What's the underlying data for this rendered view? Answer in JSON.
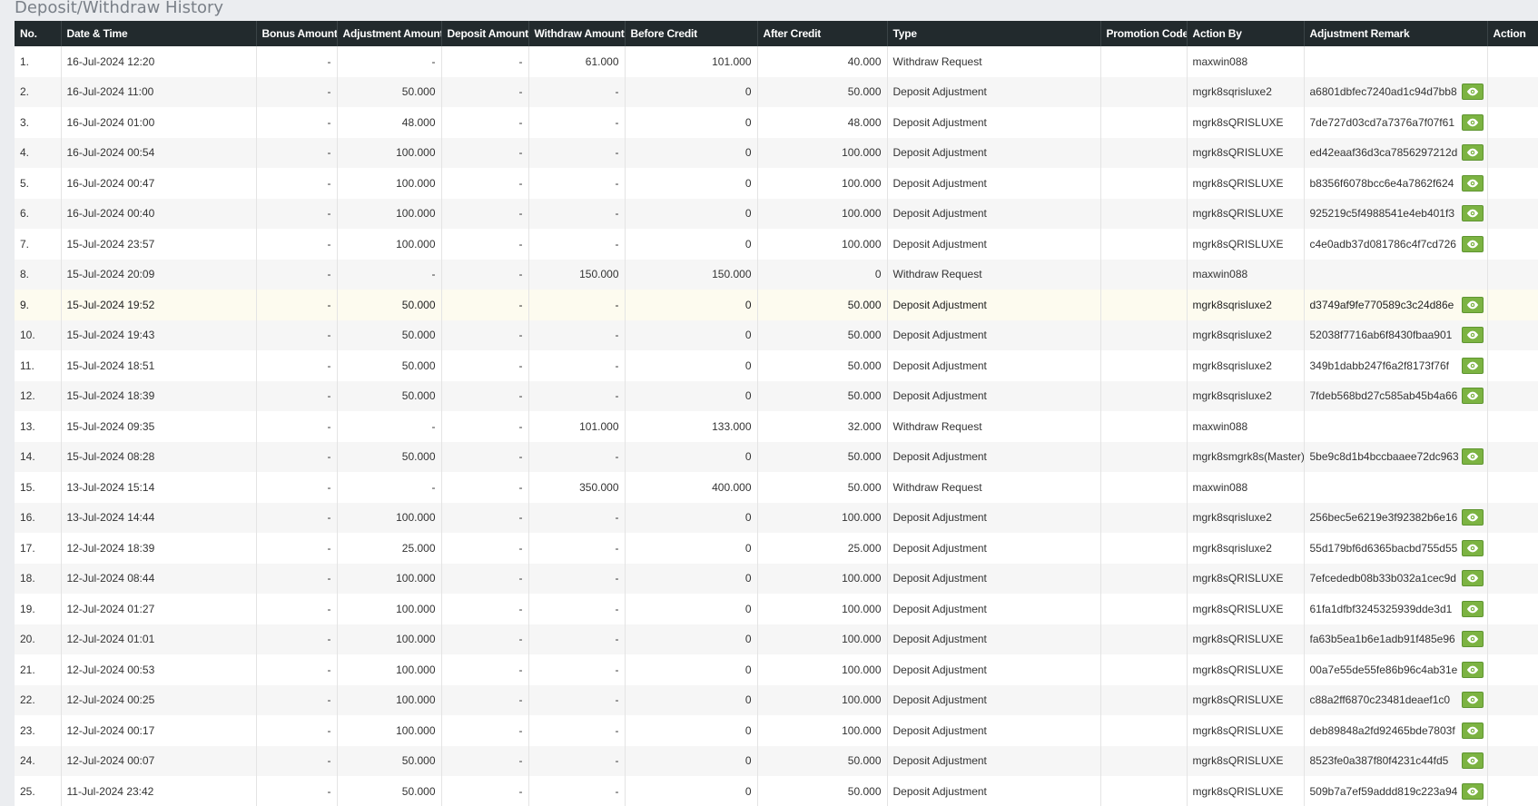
{
  "page_title": "Deposit/Withdraw History",
  "columns": [
    "No.",
    "Date & Time",
    "Bonus Amount",
    "Adjustment Amount",
    "Deposit Amount",
    "Withdraw Amount",
    "Before Credit",
    "After Credit",
    "Type",
    "Promotion Code",
    "Action By",
    "Adjustment Remark",
    "Action"
  ],
  "colors": {
    "header_bg": "#222a2d",
    "eye_button": "#7cb342",
    "highlight_row": "#fdfbef"
  },
  "view_icon": "eye-icon",
  "rows": [
    {
      "no": "1.",
      "date": "16-Jul-2024 12:20",
      "bonus": "-",
      "adjustment": "-",
      "deposit": "-",
      "withdraw": "61.000",
      "before": "101.000",
      "after": "40.000",
      "type": "Withdraw Request",
      "promo": "",
      "by": "maxwin088",
      "remark": "",
      "has_view": false
    },
    {
      "no": "2.",
      "date": "16-Jul-2024 11:00",
      "bonus": "-",
      "adjustment": "50.000",
      "deposit": "-",
      "withdraw": "-",
      "before": "0",
      "after": "50.000",
      "type": "Deposit Adjustment",
      "promo": "",
      "by": "mgrk8sqrisluxe2",
      "remark": "a6801dbfec7240ad1c94d7bb8",
      "has_view": true
    },
    {
      "no": "3.",
      "date": "16-Jul-2024 01:00",
      "bonus": "-",
      "adjustment": "48.000",
      "deposit": "-",
      "withdraw": "-",
      "before": "0",
      "after": "48.000",
      "type": "Deposit Adjustment",
      "promo": "",
      "by": "mgrk8sQRISLUXE",
      "remark": "7de727d03cd7a7376a7f07f61",
      "has_view": true
    },
    {
      "no": "4.",
      "date": "16-Jul-2024 00:54",
      "bonus": "-",
      "adjustment": "100.000",
      "deposit": "-",
      "withdraw": "-",
      "before": "0",
      "after": "100.000",
      "type": "Deposit Adjustment",
      "promo": "",
      "by": "mgrk8sQRISLUXE",
      "remark": "ed42eaaf36d3ca7856297212d",
      "has_view": true
    },
    {
      "no": "5.",
      "date": "16-Jul-2024 00:47",
      "bonus": "-",
      "adjustment": "100.000",
      "deposit": "-",
      "withdraw": "-",
      "before": "0",
      "after": "100.000",
      "type": "Deposit Adjustment",
      "promo": "",
      "by": "mgrk8sQRISLUXE",
      "remark": "b8356f6078bcc6e4a7862f624",
      "has_view": true
    },
    {
      "no": "6.",
      "date": "16-Jul-2024 00:40",
      "bonus": "-",
      "adjustment": "100.000",
      "deposit": "-",
      "withdraw": "-",
      "before": "0",
      "after": "100.000",
      "type": "Deposit Adjustment",
      "promo": "",
      "by": "mgrk8sQRISLUXE",
      "remark": "925219c5f4988541e4eb401f3",
      "has_view": true
    },
    {
      "no": "7.",
      "date": "15-Jul-2024 23:57",
      "bonus": "-",
      "adjustment": "100.000",
      "deposit": "-",
      "withdraw": "-",
      "before": "0",
      "after": "100.000",
      "type": "Deposit Adjustment",
      "promo": "",
      "by": "mgrk8sQRISLUXE",
      "remark": "c4e0adb37d081786c4f7cd726",
      "has_view": true
    },
    {
      "no": "8.",
      "date": "15-Jul-2024 20:09",
      "bonus": "-",
      "adjustment": "-",
      "deposit": "-",
      "withdraw": "150.000",
      "before": "150.000",
      "after": "0",
      "type": "Withdraw Request",
      "promo": "",
      "by": "maxwin088",
      "remark": "",
      "has_view": false
    },
    {
      "no": "9.",
      "date": "15-Jul-2024 19:52",
      "bonus": "-",
      "adjustment": "50.000",
      "deposit": "-",
      "withdraw": "-",
      "before": "0",
      "after": "50.000",
      "type": "Deposit Adjustment",
      "promo": "",
      "by": "mgrk8sqrisluxe2",
      "remark": "d3749af9fe770589c3c24d86e",
      "has_view": true
    },
    {
      "no": "10.",
      "date": "15-Jul-2024 19:43",
      "bonus": "-",
      "adjustment": "50.000",
      "deposit": "-",
      "withdraw": "-",
      "before": "0",
      "after": "50.000",
      "type": "Deposit Adjustment",
      "promo": "",
      "by": "mgrk8sqrisluxe2",
      "remark": "52038f7716ab6f8430fbaa901",
      "has_view": true
    },
    {
      "no": "11.",
      "date": "15-Jul-2024 18:51",
      "bonus": "-",
      "adjustment": "50.000",
      "deposit": "-",
      "withdraw": "-",
      "before": "0",
      "after": "50.000",
      "type": "Deposit Adjustment",
      "promo": "",
      "by": "mgrk8sqrisluxe2",
      "remark": "349b1dabb247f6a2f8173f76f",
      "has_view": true
    },
    {
      "no": "12.",
      "date": "15-Jul-2024 18:39",
      "bonus": "-",
      "adjustment": "50.000",
      "deposit": "-",
      "withdraw": "-",
      "before": "0",
      "after": "50.000",
      "type": "Deposit Adjustment",
      "promo": "",
      "by": "mgrk8sqrisluxe2",
      "remark": "7fdeb568bd27c585ab45b4a66",
      "has_view": true
    },
    {
      "no": "13.",
      "date": "15-Jul-2024 09:35",
      "bonus": "-",
      "adjustment": "-",
      "deposit": "-",
      "withdraw": "101.000",
      "before": "133.000",
      "after": "32.000",
      "type": "Withdraw Request",
      "promo": "",
      "by": "maxwin088",
      "remark": "",
      "has_view": false
    },
    {
      "no": "14.",
      "date": "15-Jul-2024 08:28",
      "bonus": "-",
      "adjustment": "50.000",
      "deposit": "-",
      "withdraw": "-",
      "before": "0",
      "after": "50.000",
      "type": "Deposit Adjustment",
      "promo": "",
      "by": "mgrk8smgrk8s(Master)",
      "remark": "5be9c8d1b4bccbaaee72dc963",
      "has_view": true
    },
    {
      "no": "15.",
      "date": "13-Jul-2024 15:14",
      "bonus": "-",
      "adjustment": "-",
      "deposit": "-",
      "withdraw": "350.000",
      "before": "400.000",
      "after": "50.000",
      "type": "Withdraw Request",
      "promo": "",
      "by": "maxwin088",
      "remark": "",
      "has_view": false
    },
    {
      "no": "16.",
      "date": "13-Jul-2024 14:44",
      "bonus": "-",
      "adjustment": "100.000",
      "deposit": "-",
      "withdraw": "-",
      "before": "0",
      "after": "100.000",
      "type": "Deposit Adjustment",
      "promo": "",
      "by": "mgrk8sqrisluxe2",
      "remark": "256bec5e6219e3f92382b6e16",
      "has_view": true
    },
    {
      "no": "17.",
      "date": "12-Jul-2024 18:39",
      "bonus": "-",
      "adjustment": "25.000",
      "deposit": "-",
      "withdraw": "-",
      "before": "0",
      "after": "25.000",
      "type": "Deposit Adjustment",
      "promo": "",
      "by": "mgrk8sqrisluxe2",
      "remark": "55d179bf6d6365bacbd755d55",
      "has_view": true
    },
    {
      "no": "18.",
      "date": "12-Jul-2024 08:44",
      "bonus": "-",
      "adjustment": "100.000",
      "deposit": "-",
      "withdraw": "-",
      "before": "0",
      "after": "100.000",
      "type": "Deposit Adjustment",
      "promo": "",
      "by": "mgrk8sQRISLUXE",
      "remark": "7efcededb08b33b032a1cec9d",
      "has_view": true
    },
    {
      "no": "19.",
      "date": "12-Jul-2024 01:27",
      "bonus": "-",
      "adjustment": "100.000",
      "deposit": "-",
      "withdraw": "-",
      "before": "0",
      "after": "100.000",
      "type": "Deposit Adjustment",
      "promo": "",
      "by": "mgrk8sQRISLUXE",
      "remark": "61fa1dfbf3245325939dde3d1",
      "has_view": true
    },
    {
      "no": "20.",
      "date": "12-Jul-2024 01:01",
      "bonus": "-",
      "adjustment": "100.000",
      "deposit": "-",
      "withdraw": "-",
      "before": "0",
      "after": "100.000",
      "type": "Deposit Adjustment",
      "promo": "",
      "by": "mgrk8sQRISLUXE",
      "remark": "fa63b5ea1b6e1adb91f485e96",
      "has_view": true
    },
    {
      "no": "21.",
      "date": "12-Jul-2024 00:53",
      "bonus": "-",
      "adjustment": "100.000",
      "deposit": "-",
      "withdraw": "-",
      "before": "0",
      "after": "100.000",
      "type": "Deposit Adjustment",
      "promo": "",
      "by": "mgrk8sQRISLUXE",
      "remark": "00a7e55de55fe86b96c4ab31e",
      "has_view": true
    },
    {
      "no": "22.",
      "date": "12-Jul-2024 00:25",
      "bonus": "-",
      "adjustment": "100.000",
      "deposit": "-",
      "withdraw": "-",
      "before": "0",
      "after": "100.000",
      "type": "Deposit Adjustment",
      "promo": "",
      "by": "mgrk8sQRISLUXE",
      "remark": "c88a2ff6870c23481deaef1c0",
      "has_view": true
    },
    {
      "no": "23.",
      "date": "12-Jul-2024 00:17",
      "bonus": "-",
      "adjustment": "100.000",
      "deposit": "-",
      "withdraw": "-",
      "before": "0",
      "after": "100.000",
      "type": "Deposit Adjustment",
      "promo": "",
      "by": "mgrk8sQRISLUXE",
      "remark": "deb89848a2fd92465bde7803f",
      "has_view": true
    },
    {
      "no": "24.",
      "date": "12-Jul-2024 00:07",
      "bonus": "-",
      "adjustment": "50.000",
      "deposit": "-",
      "withdraw": "-",
      "before": "0",
      "after": "50.000",
      "type": "Deposit Adjustment",
      "promo": "",
      "by": "mgrk8sQRISLUXE",
      "remark": "8523fe0a387f80f4231c44fd5",
      "has_view": true
    },
    {
      "no": "25.",
      "date": "11-Jul-2024 23:42",
      "bonus": "-",
      "adjustment": "50.000",
      "deposit": "-",
      "withdraw": "-",
      "before": "0",
      "after": "50.000",
      "type": "Deposit Adjustment",
      "promo": "",
      "by": "mgrk8sQRISLUXE",
      "remark": "509b7a7ef59addd819c223a94",
      "has_view": true
    }
  ]
}
